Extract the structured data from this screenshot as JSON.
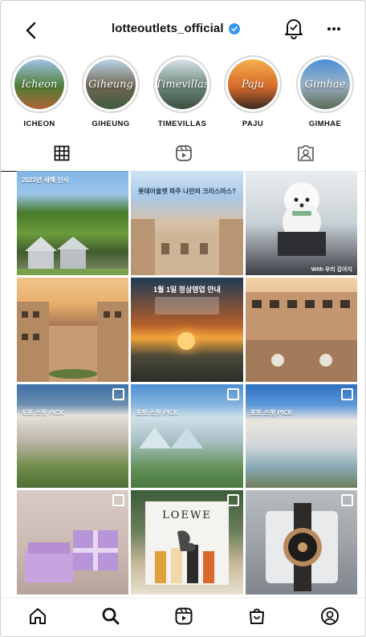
{
  "header": {
    "username": "lotteoutlets_official",
    "verified": true
  },
  "highlights": [
    {
      "label": "ICHEON",
      "cover_text": "Icheon",
      "color": "#5b7a3a"
    },
    {
      "label": "GIHEUNG",
      "cover_text": "Giheung",
      "color": "#6a6f5c"
    },
    {
      "label": "TIMEVILLAS",
      "cover_text": "Timevillas",
      "color": "#526b63"
    },
    {
      "label": "PAJU",
      "cover_text": "Paju",
      "color": "#d18a33"
    },
    {
      "label": "GIMHAE",
      "cover_text": "Gimhae",
      "color": "#5d6d83"
    }
  ],
  "tabs": [
    {
      "name": "grid-icon",
      "active": true
    },
    {
      "name": "reels-icon",
      "active": false
    },
    {
      "name": "tagged-icon",
      "active": false
    }
  ],
  "posts": [
    {
      "caption": "2023년 새해 인사",
      "style": "green-valley",
      "multi": false
    },
    {
      "caption": "롯데아울렛 파주 나만의 크리스마스?",
      "style": "atrium",
      "multi": false
    },
    {
      "caption": "With 우리 강아지",
      "style": "puppy",
      "multi": false
    },
    {
      "caption": "",
      "style": "sunset-courtyard",
      "multi": false
    },
    {
      "caption": "1월 1일 정상영업 안내",
      "style": "sunrise",
      "multi": false
    },
    {
      "caption": "",
      "style": "terrace",
      "multi": false
    },
    {
      "caption": "포토 스팟 PICK",
      "style": "photo-pick-1",
      "multi": true
    },
    {
      "caption": "포토 스팟 PICK",
      "style": "photo-pick-2",
      "multi": true
    },
    {
      "caption": "포토 스팟 PICK",
      "style": "photo-pick-3",
      "multi": true
    },
    {
      "caption": "",
      "style": "gift-box",
      "multi": true
    },
    {
      "caption": "LOEWE",
      "style": "loewe",
      "multi": true
    },
    {
      "caption": "",
      "style": "watch",
      "multi": true
    }
  ],
  "bottom_nav": [
    "home-icon",
    "search-icon",
    "reels-icon",
    "shop-icon",
    "profile-icon"
  ]
}
